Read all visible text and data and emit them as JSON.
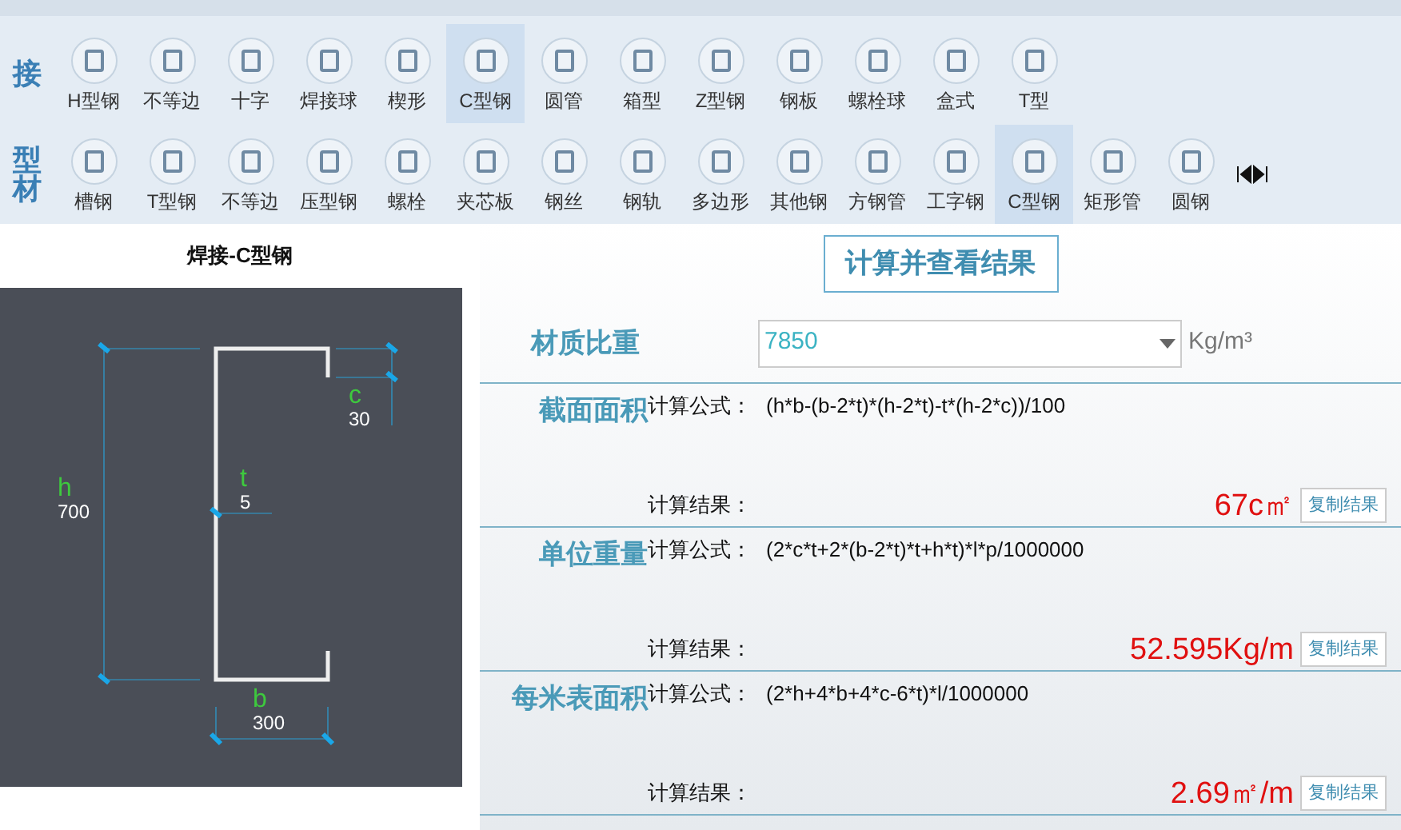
{
  "toolbar": [
    {
      "side_label": "接",
      "items": [
        {
          "label": "H型钢",
          "selected": false
        },
        {
          "label": "不等边",
          "selected": false
        },
        {
          "label": "十字",
          "selected": false
        },
        {
          "label": "焊接球",
          "selected": false
        },
        {
          "label": "楔形",
          "selected": false
        },
        {
          "label": "C型钢",
          "selected": true
        },
        {
          "label": "圆管",
          "selected": false
        },
        {
          "label": "箱型",
          "selected": false
        },
        {
          "label": "Z型钢",
          "selected": false
        },
        {
          "label": "钢板",
          "selected": false
        },
        {
          "label": "螺栓球",
          "selected": false
        },
        {
          "label": "盒式",
          "selected": false
        },
        {
          "label": "T型",
          "selected": false
        }
      ]
    },
    {
      "side_label": "型材",
      "items": [
        {
          "label": "槽钢",
          "selected": false
        },
        {
          "label": "T型钢",
          "selected": false
        },
        {
          "label": "不等边",
          "selected": false
        },
        {
          "label": "压型钢",
          "selected": false
        },
        {
          "label": "螺栓",
          "selected": false
        },
        {
          "label": "夹芯板",
          "selected": false
        },
        {
          "label": "钢丝",
          "selected": false
        },
        {
          "label": "钢轨",
          "selected": false
        },
        {
          "label": "多边形",
          "selected": false
        },
        {
          "label": "其他钢",
          "selected": false
        },
        {
          "label": "方钢管",
          "selected": false
        },
        {
          "label": "工字钢",
          "selected": false
        },
        {
          "label": "C型钢",
          "selected": true
        },
        {
          "label": "矩形管",
          "selected": false
        },
        {
          "label": "圆钢",
          "selected": false
        }
      ]
    }
  ],
  "diagram": {
    "title": "焊接-C型钢",
    "dimensions": {
      "h": {
        "symbol": "h",
        "value": "700"
      },
      "b": {
        "symbol": "b",
        "value": "300"
      },
      "c": {
        "symbol": "c",
        "value": "30"
      },
      "t": {
        "symbol": "t",
        "value": "5"
      }
    }
  },
  "calculate_button": "计算并查看结果",
  "density": {
    "label": "材质比重",
    "value": "7850",
    "unit": "Kg/m³"
  },
  "sections": [
    {
      "name": "截面面积",
      "formula_label": "计算公式：",
      "formula": "(h*b-(b-2*t)*(h-2*t)-t*(h-2*c))/100",
      "result_label": "计算结果：",
      "result": "67c㎡",
      "copy_button": "复制结果"
    },
    {
      "name": "单位重量",
      "formula_label": "计算公式：",
      "formula": "(2*c*t+2*(b-2*t)*t+h*t)*l*p/1000000",
      "result_label": "计算结果：",
      "result": "52.595Kg/m",
      "copy_button": "复制结果"
    },
    {
      "name": "每米表面积",
      "formula_label": "计算公式：",
      "formula": "(2*h+4*b+4*c-6*t)*l/1000000",
      "result_label": "计算结果：",
      "result": "2.69㎡/m",
      "copy_button": "复制结果"
    }
  ]
}
